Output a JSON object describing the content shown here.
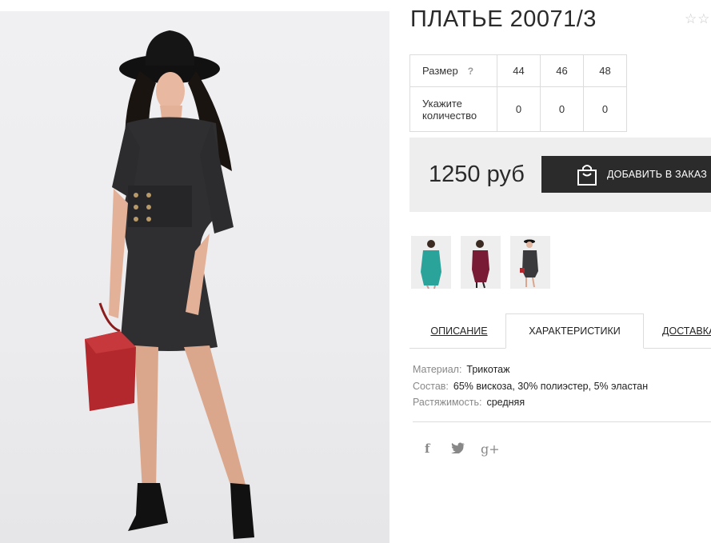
{
  "product": {
    "title": "ПЛАТЬЕ 20071/3",
    "rating_stars": "☆☆",
    "image_alt": "model-in-black-dress-photo"
  },
  "size_table": {
    "size_label": "Размер",
    "help": "?",
    "sizes": [
      "44",
      "46",
      "48"
    ],
    "qty_label_1": "Укажите",
    "qty_label_2": "количество",
    "quantities": [
      "0",
      "0",
      "0"
    ]
  },
  "purchase": {
    "price": "1250 руб",
    "add_label": "ДОБАВИТЬ В ЗАКАЗ"
  },
  "thumbnails": [
    {
      "color": "#2aa39a"
    },
    {
      "color": "#7a1b36"
    },
    {
      "color": "#3a3a3c"
    }
  ],
  "tabs": {
    "description": "ОПИСАНИЕ",
    "characteristics": "ХАРАКТЕРИСТИКИ",
    "delivery": "ДОСТАВКА"
  },
  "specs": [
    {
      "key": "Материал:",
      "value": "Трикотаж"
    },
    {
      "key": "Состав:",
      "value": "65% вискоза, 30% полиэстер, 5% эластан"
    },
    {
      "key": "Растяжимость:",
      "value": "средняя"
    }
  ],
  "social": {
    "facebook": "f",
    "twitter": "🐦",
    "gplus": "g+"
  },
  "colors": {
    "button_bg": "#2b2b2b",
    "panel_bg": "#eeeeee",
    "border": "#dcdcdc",
    "muted_text": "#888888"
  }
}
